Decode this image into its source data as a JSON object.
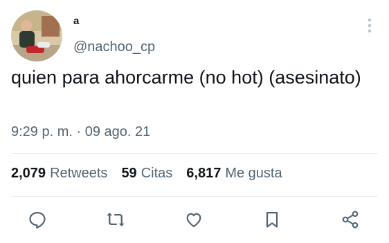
{
  "author": {
    "display_name": "a",
    "handle": "@nachoo_cp"
  },
  "tweet": {
    "text": "quien para ahorcarme (no hot) (asesinato)",
    "time": "9:29 p. m.",
    "separator": "·",
    "date": "09 ago. 21"
  },
  "stats": {
    "retweets_count": "2,079",
    "retweets_label": "Retweets",
    "quotes_count": "59",
    "quotes_label": "Citas",
    "likes_count": "6,817",
    "likes_label": "Me gusta"
  },
  "icons": {
    "more": "more-vertical-icon",
    "reply": "reply-icon",
    "retweet": "retweet-icon",
    "like": "heart-icon",
    "bookmark": "bookmark-icon",
    "share": "share-icon"
  },
  "colors": {
    "secondary_text": "#536471",
    "primary_text": "#0f1419",
    "divider": "#e6ecf0"
  }
}
